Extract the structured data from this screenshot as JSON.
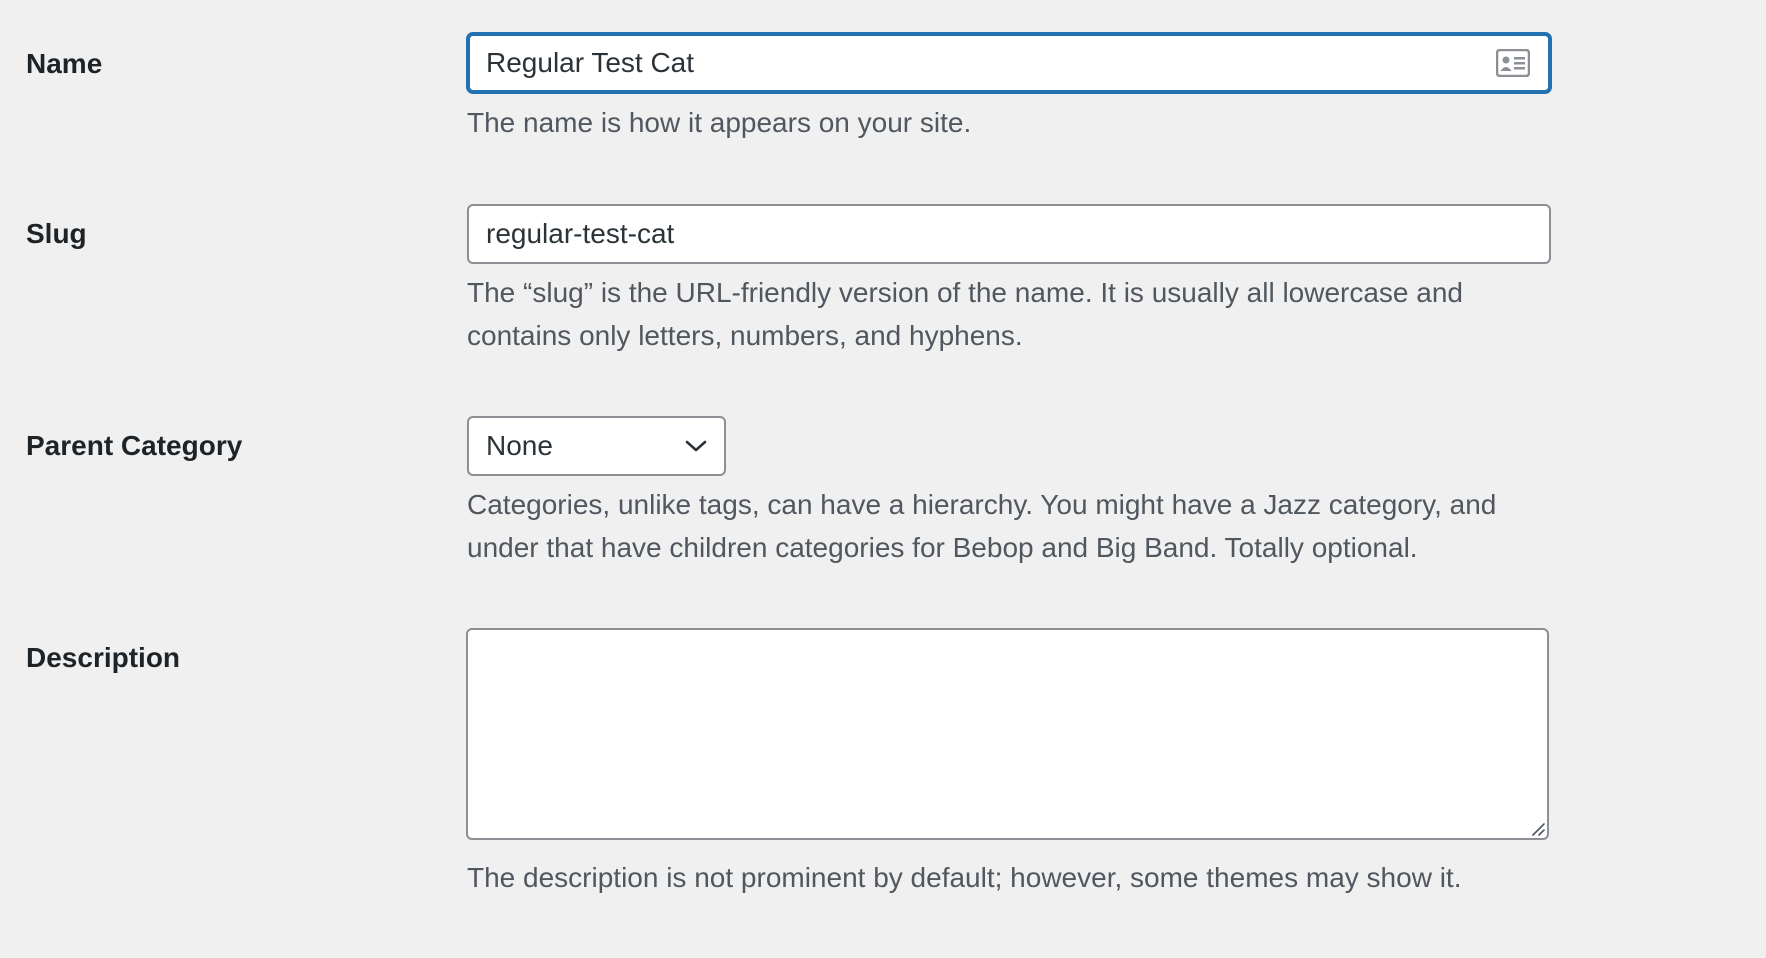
{
  "form": {
    "name": {
      "label": "Name",
      "value": "Regular Test Cat",
      "help": "The name is how it appears on your site.",
      "icon": "contact-card-icon"
    },
    "slug": {
      "label": "Slug",
      "value": "regular-test-cat",
      "help": "The “slug” is the URL-friendly version of the name. It is usually all lowercase and contains only letters, numbers, and hyphens."
    },
    "parent": {
      "label": "Parent Category",
      "selected": "None",
      "help": "Categories, unlike tags, can have a hierarchy. You might have a Jazz category, and under that have children categories for Bebop and Big Band. Totally optional.",
      "icon": "chevron-down-icon"
    },
    "description": {
      "label": "Description",
      "value": "",
      "help": "The description is not prominent by default; however, some themes may show it.",
      "icon": "resize-handle-icon"
    }
  },
  "colors": {
    "background": "#f0f0f1",
    "focus_border": "#2271b1",
    "field_border": "#8c8f94",
    "help_text": "#50575e",
    "label_text": "#1d2327"
  }
}
